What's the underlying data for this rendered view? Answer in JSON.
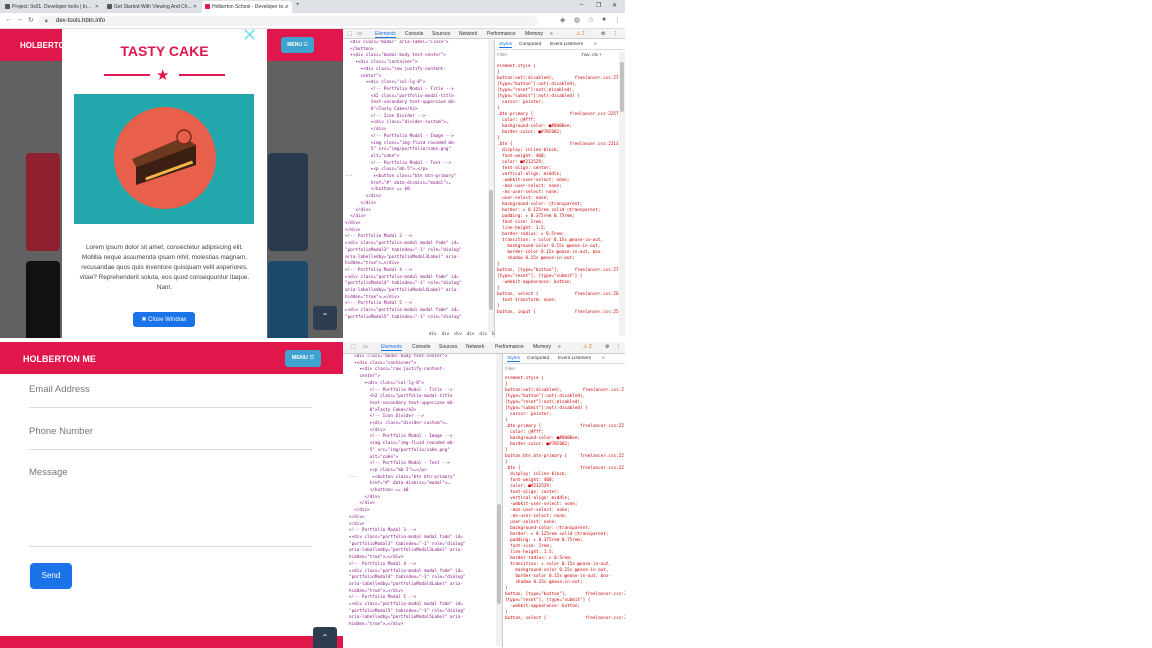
{
  "browser": {
    "tabs": [
      {
        "label": "Project: 0x01. Developer tools | In..."
      },
      {
        "label": "Get Started With Viewing And Ch..."
      },
      {
        "label": "Holberton School - Developer to..."
      }
    ],
    "url": "dev-tools.hbtn.info",
    "new_tab": "+",
    "window_controls": [
      "–",
      "❐",
      "✕"
    ]
  },
  "site": {
    "brand": "HOLBERTON ME",
    "menu_label": "MENU ☰",
    "modal": {
      "close_x": "✕",
      "title": "TASTY CAKE",
      "star": "★",
      "body": "Lorem ipsum dolor sit amet, consectetur adipisicing elit. Mollitia neque assumenda ipsam nihil, molestias magnam, recusandae quos quis inventore quisquam velit asperiores, vitae? Reprehenderit soluta, eos quod consequuntur itaque. Nam.",
      "close_button": "✖ Close Window"
    },
    "scroll_up": "⌃",
    "form": {
      "email": "Email Address",
      "phone": "Phone Number",
      "message": "Message",
      "send": "Send"
    }
  },
  "devtools": {
    "tabs": [
      "Elements",
      "Console",
      "Sources",
      "Network",
      "Performance",
      "Memory",
      "»"
    ],
    "warnings": "⚠ 2",
    "breadcrumb": "div  div  div  div  div  button.btn.btn-primary",
    "elements_top": "  <div class=\"modal\" aria-label=\"Close\">\n  </button>\n  ▾<div class=\"modal-body text-center\">\n    ▾<div class=\"container\">\n      ▾<div class=\"row justify-content-\n      center\">\n        ▾<div class=\"col-lg-8\">\n          <!-- Portfolio Modal - Title -->\n          <h2 class=\"portfolio-modal-title\n          text-secondary text-uppercase mb-\n          0\">Tasty Cake</h2>\n          <!-- Icon Divider -->\n          ▸<div class=\"divider-custom\">…\n          </div>\n          <!-- Portfolio Modal - Image -->\n          <img class=\"img-fluid rounded mb-\n          5\" src=\"img/portfolio/cake.png\"\n          alt=\"cake\">\n          <!-- Portfolio Modal - Text -->\n          ▸<p class=\"mb-5\">…</p>\n···        ▸<button class=\"btn btn-primary\"\n          href=\"#\" data-dismiss=\"modal\">…\n          </button> == $0\n        </div>\n      </div>\n    </div>\n  </div>\n</div>\n</div>\n<!-- Portfolio Modal 3 -->\n▸<div class=\"portfolio-modal modal fade\" id=\n\"portfolioModal3\" tabindex=\"-1\" role=\"dialog\"\naria-labelledby=\"portfolioModal3Label\" aria-\nhidden=\"true\">…</div>\n<!-- Portfolio Modal 4 -->\n▸<div class=\"portfolio-modal modal fade\" id=\n\"portfolioModal4\" tabindex=\"-1\" role=\"dialog\"\naria-labelledby=\"portfolioModal4Label\" aria-\nhidden=\"true\">…</div>\n<!-- Portfolio Modal 5 -->\n▸<div class=\"portfolio-modal modal fade\" id=\n\"portfolioModal5\" tabindex=\"-1\" role=\"dialog\"",
    "styles_tabs": [
      "Styles",
      "Computed",
      "Event Listeners",
      "»"
    ],
    "filter_placeholder": "Filter",
    "filter_tools": ":hov  .cls  +",
    "css_top": "element.style {\n}\nbutton:not(:disabled),        freelancer.css:273\n[type=\"button\"]:not(:disabled),\n[type=\"reset\"]:not(:disabled),\n[type=\"submit\"]:not(:disabled) {\n  cursor: pointer;\n}\n.btn-primary {              freelancer.css:2257\n  color: □#fff;\n  background-color: ■#0000ee;\n  border-color: ■#78C002;\n}\n.btn {                      freelancer.css:2213\n  display: inline-block;\n  font-weight: 400;\n  color: ■#212529;\n  text-align: center;\n  vertical-align: middle;\n  -webkit-user-select: none;\n  -moz-user-select: none;\n  -ms-user-select: none;\n  user-select: none;\n  background-color: ▢transparent;\n  border: ▸ 0.125rem solid ▢transparent;\n  padding: ▸ 0.375rem 0.75rem;\n  font-size: 1rem;\n  line-height: 1.5;\n  border-radius: ▸ 0.5rem;\n  transition: ▸ color 0.15s ▤ease-in-out,\n    background-color 0.15s ▤ease-in-out,\n    border-color 0.15s ▤ease-in-out, box-\n    shadow 0.15s ▤ease-in-out;\n}\nbutton, [type=\"button\"],      freelancer.css:273\n[type=\"reset\"], [type=\"submit\"] {\n  -webkit-appearance: button;\n}\nbutton, select {              freelancer.css:261\n  text-transform: none;\n}\nbutton, input {               freelancer.css:250",
    "elements_bottom": "  <div class=\"modal-body text-center\">\n  ▾<div class=\"container\">\n    ▾<div class=\"row justify-content-\n    center\">\n      ▾<div class=\"col-lg-8\">\n        <!-- Portfolio Modal - Title -->\n        <h2 class=\"portfolio-modal-title\n        text-secondary text-uppercase mb-\n        0\">Tasty Cake</h2>\n        <!-- Icon Divider -->\n        ▸<div class=\"divider-custom\">…\n        </div>\n        <!-- Portfolio Modal - Image -->\n        <img class=\"img-fluid rounded mb-\n        5\" src=\"img/portfolio/cake.png\"\n        alt=\"cake\">\n        <!-- Portfolio Modal - Text -->\n        ▸<p class=\"mb-5\">…</p>\n···      ▸<button class=\"btn btn-primary\"\n        href=\"#\" data-dismiss=\"modal\">…\n        </button> == $0\n      </div>\n    </div>\n  </div>\n</div>\n</div>\n<!-- Portfolio Modal 3 -->\n▸<div class=\"portfolio-modal modal fade\" id=\n\"portfolioModal3\" tabindex=\"-1\" role=\"dialog\"\naria-labelledby=\"portfolioModal3Label\" aria-\nhidden=\"true\">…</div>\n<!-- Portfolio Modal 4 -->\n▸<div class=\"portfolio-modal modal fade\" id=\n\"portfolioModal4\" tabindex=\"-1\" role=\"dialog\"\naria-labelledby=\"portfolioModal4Label\" aria-\nhidden=\"true\">…</div>\n<!-- Portfolio Modal 5 -->\n▸<div class=\"portfolio-modal modal fade\" id=\n\"portfolioModal5\" tabindex=\"-1\" role=\"dialog\"\naria-labelledby=\"portfolioModal5Label\" aria-\nhidden=\"true\">…</div>",
    "css_bottom": "element.style {\n}\nbutton:not(:disabled),        freelancer.css:2\n[type=\"button\"]:not(:disabled),\n[type=\"reset\"]:not(:disabled),\n[type=\"submit\"]:not(:disabled) {\n  cursor: pointer;\n}\n.btn-primary {               freelancer.css:22\n  color: □#fff;\n  background-color: ■#0000ee;\n  border-color: ■#78C002;\n}\nbutton.btn.btn-primary {     freelancer.css:22\n}\n.btn {                       freelancer.css:22\n  display: inline-block;\n  font-weight: 400;\n  color: ■#212529;\n  text-align: center;\n  vertical-align: middle;\n  -webkit-user-select: none;\n  -moz-user-select: none;\n  -ms-user-select: none;\n  user-select: none;\n  background-color: ▢transparent;\n  border: ▸ 0.125rem solid ▢transparent;\n  padding: ▸ 0.375rem 0.75rem;\n  font-size: 1rem;\n  line-height: 1.5;\n  border-radius: ▸ 0.5rem;\n  transition: ▸ color 0.15s ▤ease-in-out,\n    background-color 0.15s ▤ease-in-out,\n    border-color 0.15s ▤ease-in-out, box-\n    shadow 0.15s ▤ease-in-out;\n}\nbutton, [type=\"button\"],       freelancer.css:2\n[type=\"reset\"], [type=\"submit\"] {\n  -webkit-appearance: button;\n}\nbutton, select {               freelancer.css:2"
  },
  "colors": {
    "brand": "#e0174b",
    "accent": "#1a73e8",
    "menu": "#3fa3cf",
    "teal": "#22a7ad"
  }
}
